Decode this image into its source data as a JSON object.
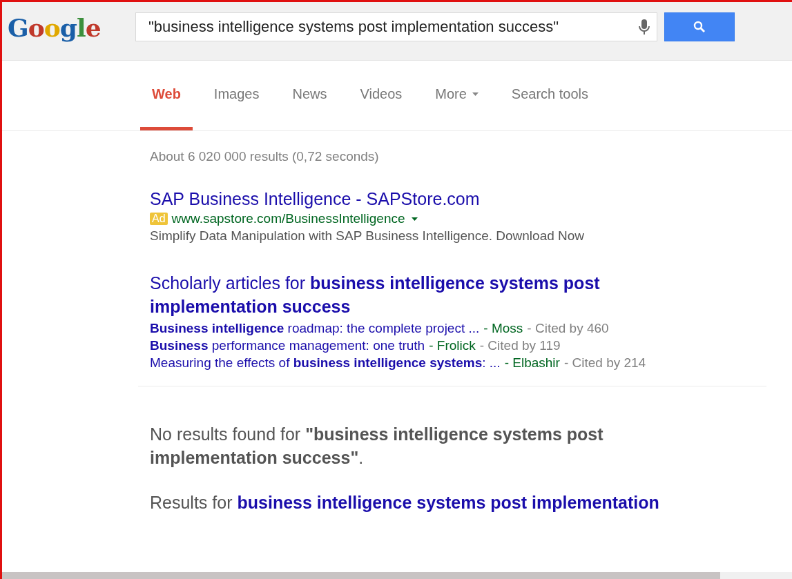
{
  "logo": {
    "text": "Google"
  },
  "search": {
    "value": "\"business intelligence systems post implementation success\""
  },
  "tabs": [
    {
      "label": "Web",
      "selected": true,
      "kind": "tab"
    },
    {
      "label": "Images",
      "selected": false,
      "kind": "tab"
    },
    {
      "label": "News",
      "selected": false,
      "kind": "tab"
    },
    {
      "label": "Videos",
      "selected": false,
      "kind": "tab"
    },
    {
      "label": "More",
      "selected": false,
      "kind": "menu"
    },
    {
      "label": "Search tools",
      "selected": false,
      "kind": "tab"
    }
  ],
  "result_stats": "About 6 020 000 results (0,72 seconds)",
  "ad": {
    "title": "SAP Business Intelligence - SAPStore.com",
    "badge": "Ad",
    "url": "www.sapstore.com/BusinessIntelligence",
    "description": "Simplify Data Manipulation with SAP Business Intelligence. Download Now"
  },
  "scholarly": {
    "heading": "Scholarly articles for **business intelligence systems post implementation success**",
    "items": [
      {
        "title": "**Business intelligence** roadmap: the complete project ...",
        "author": "- Moss",
        "cited": "- Cited by 460"
      },
      {
        "title": "**Business** performance management: one truth",
        "author": "- Frolick",
        "cited": "- Cited by 119"
      },
      {
        "title": "Measuring the effects of **business intelligence systems**: ...",
        "author": "- Elbashir",
        "cited": "- Cited by 214"
      }
    ]
  },
  "no_results": "No results found for **\"business intelligence systems post implementation success\"**.",
  "results_for": {
    "label": "Results for",
    "query": "business intelligence systems post implementation"
  }
}
